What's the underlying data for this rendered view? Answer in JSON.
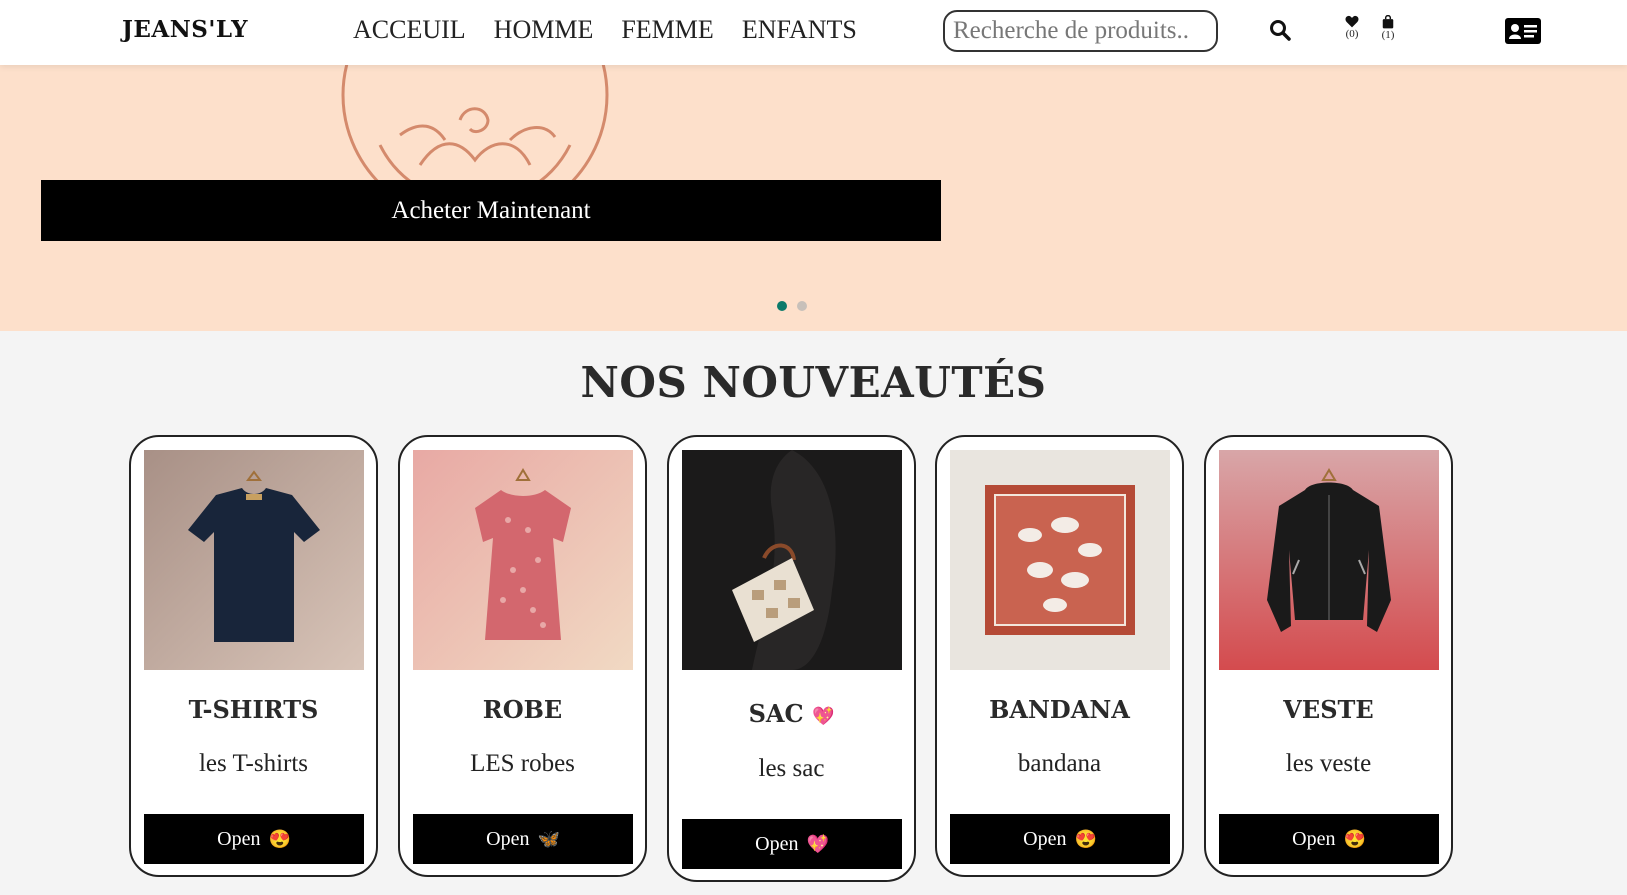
{
  "brand": {
    "logo": "JEANS'LY"
  },
  "nav": {
    "items": [
      "ACCEUIL",
      "HOMME",
      "FEMME",
      "ENFANTS"
    ]
  },
  "search": {
    "placeholder": "Recherche de produits.."
  },
  "header_icons": {
    "wishlist_count": "(0)",
    "cart_count": "(1)",
    "search_icon": "search-icon",
    "wishlist_icon": "heart-icon",
    "cart_icon": "shopping-bag-icon",
    "account_icon": "id-card-icon"
  },
  "hero": {
    "button_label": "Acheter Maintenant",
    "slides": 2,
    "active_slide": 1,
    "background": "#fde0cb"
  },
  "section": {
    "title": "NOS NOUVEAUTÉS"
  },
  "products": [
    {
      "title": "T-SHIRTS",
      "subtitle": "les T-shirts",
      "button": "Open",
      "button_emoji": "😍"
    },
    {
      "title": "ROBE",
      "subtitle": "LES robes",
      "button": "Open",
      "button_emoji": "🦋"
    },
    {
      "title": "SAC",
      "title_emoji": "💖",
      "subtitle": "les sac",
      "button": "Open",
      "button_emoji": "💖"
    },
    {
      "title": "BANDANA",
      "subtitle": "bandana",
      "button": "Open",
      "button_emoji": "😍"
    },
    {
      "title": "VESTE",
      "subtitle": "les veste",
      "button": "Open",
      "button_emoji": "😍"
    }
  ],
  "colors": {
    "accent_dot": "#0b7a6a",
    "button_bg": "#000000"
  }
}
